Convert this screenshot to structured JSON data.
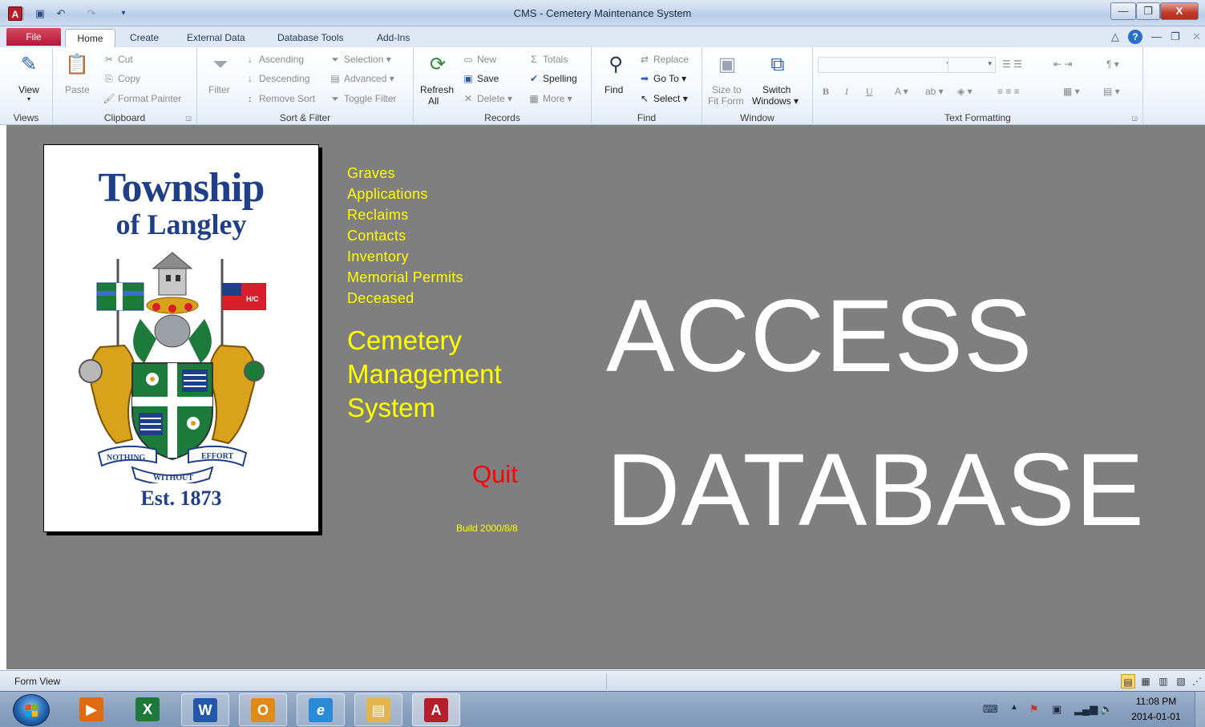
{
  "window": {
    "title": "CMS - Cemetery Maintenance System",
    "app_icon": "A",
    "controls": {
      "minimize": "—",
      "restore": "❐",
      "close": "X"
    }
  },
  "ribbon_tabs": {
    "file": "File",
    "tabs": [
      "Home",
      "Create",
      "External Data",
      "Database Tools",
      "Add-Ins"
    ],
    "active": "Home"
  },
  "ribbon": {
    "views": {
      "view": "View",
      "label": "Views"
    },
    "clipboard": {
      "paste": "Paste",
      "cut": "Cut",
      "copy": "Copy",
      "format_painter": "Format Painter",
      "label": "Clipboard"
    },
    "sort_filter": {
      "filter": "Filter",
      "ascending": "Ascending",
      "descending": "Descending",
      "remove_sort": "Remove Sort",
      "selection": "Selection",
      "advanced": "Advanced",
      "toggle_filter": "Toggle Filter",
      "label": "Sort & Filter"
    },
    "records": {
      "refresh_line1": "Refresh",
      "refresh_line2": "All",
      "new": "New",
      "save": "Save",
      "delete": "Delete",
      "totals": "Totals",
      "spelling": "Spelling",
      "more": "More",
      "label": "Records"
    },
    "find": {
      "find": "Find",
      "replace": "Replace",
      "go_to": "Go To",
      "select": "Select",
      "label": "Find"
    },
    "window": {
      "size_line1": "Size to",
      "size_line2": "Fit Form",
      "switch_line1": "Switch",
      "switch_line2": "Windows",
      "label": "Window"
    },
    "text_formatting": {
      "bold": "B",
      "italic": "I",
      "underline": "U",
      "label": "Text Formatting"
    }
  },
  "logo": {
    "line1": "Township",
    "line2": "of Langley",
    "motto_left": "NOTHING",
    "motto_right": "EFFORT",
    "motto_bottom": "WITHOUT",
    "est": "Est. 1873",
    "flag_text": "H/C"
  },
  "menu": [
    "Graves",
    "Applications",
    "Reclaims",
    "Contacts",
    "Inventory",
    "Memorial Permits",
    "Deceased"
  ],
  "system_title": [
    "Cemetery",
    "Management",
    "System"
  ],
  "quit": "Quit",
  "build": "Build 2000/8/8",
  "banner": [
    "ACCESS",
    "DATABASE"
  ],
  "status": {
    "text": "Form View"
  },
  "taskbar": {
    "apps": [
      {
        "name": "media-player",
        "glyph": "▶",
        "color": "#e06a12"
      },
      {
        "name": "excel",
        "glyph": "X",
        "color": "#1e7a3a"
      },
      {
        "name": "word",
        "glyph": "W",
        "color": "#2458a8"
      },
      {
        "name": "outlook",
        "glyph": "O",
        "color": "#e08a1a"
      },
      {
        "name": "internet-explorer",
        "glyph": "e",
        "color": "#2b8ad8"
      },
      {
        "name": "file-explorer",
        "glyph": "▤",
        "color": "#e2b64a"
      },
      {
        "name": "access",
        "glyph": "A",
        "color": "#b3202c"
      }
    ],
    "clock_time": "11:08 PM",
    "clock_date": "2014-01-01"
  },
  "colors": {
    "form_bg": "#7f7f7f",
    "menu_text": "#ffff00",
    "quit_text": "#ff0000",
    "banner_text": "#ffffff",
    "crest_blue": "#1f3f86",
    "crest_gold": "#d9a21b",
    "crest_green": "#1c7a3a"
  }
}
